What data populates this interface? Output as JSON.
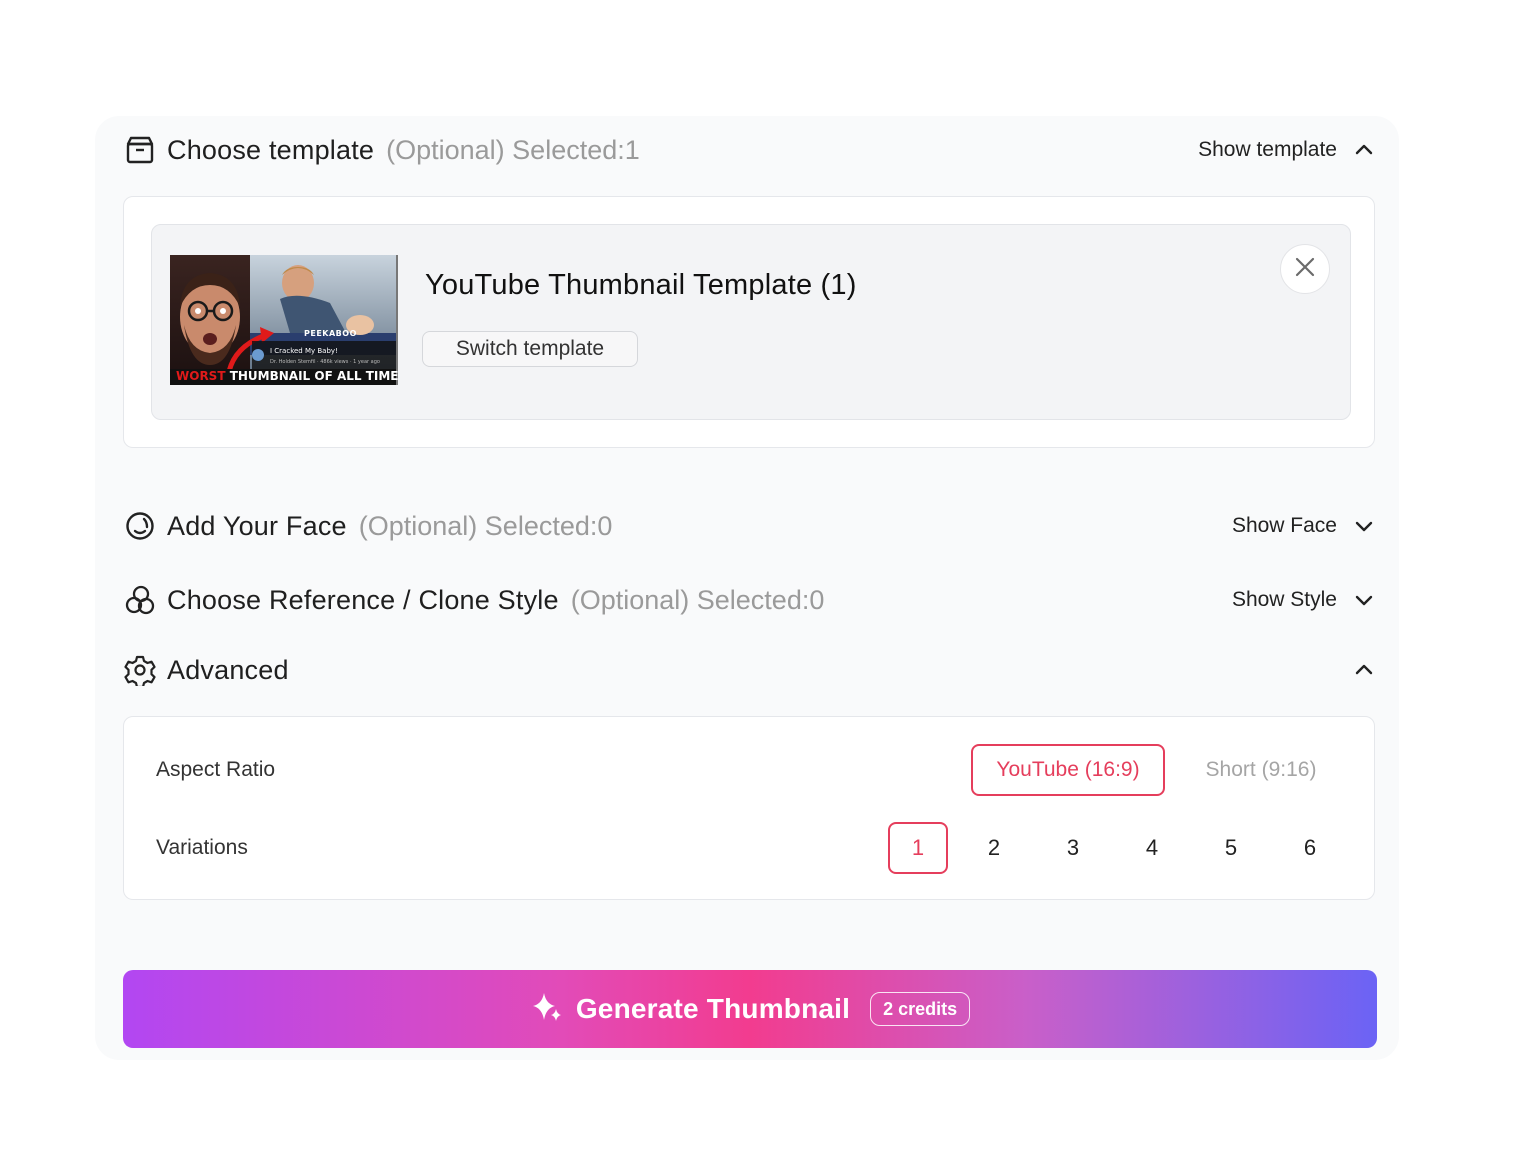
{
  "template_section": {
    "title": "Choose template",
    "optional": "(Optional) Selected:1",
    "toggle_label": "Show template",
    "selected": {
      "name": "YouTube Thumbnail Template (1)",
      "switch_label": "Switch template",
      "thumb": {
        "banner_red": "WORST",
        "banner_white": "THUMBNAIL OF ALL TIME",
        "tag": "PEEKABOO",
        "video_title": "I Cracked My Baby!",
        "video_meta": "Dr. Holden Stemfil · 486k views · 1 year ago"
      }
    }
  },
  "face_section": {
    "title": "Add Your Face",
    "optional": "(Optional) Selected:0",
    "toggle_label": "Show Face"
  },
  "style_section": {
    "title": "Choose Reference / Clone Style",
    "optional": "(Optional) Selected:0",
    "toggle_label": "Show Style"
  },
  "advanced": {
    "title": "Advanced",
    "aspect_label": "Aspect Ratio",
    "aspect_options": [
      "YouTube (16:9)",
      "Short (9:16)"
    ],
    "aspect_selected": "YouTube (16:9)",
    "variations_label": "Variations",
    "variation_options": [
      "1",
      "2",
      "3",
      "4",
      "5",
      "6"
    ],
    "variation_selected": "1"
  },
  "generate": {
    "label": "Generate Thumbnail",
    "credits": "2 credits"
  },
  "colors": {
    "accent": "#e53e5c",
    "gradient_start": "#b247f2",
    "gradient_mid": "#f23c8f",
    "gradient_end": "#6b63f5"
  }
}
